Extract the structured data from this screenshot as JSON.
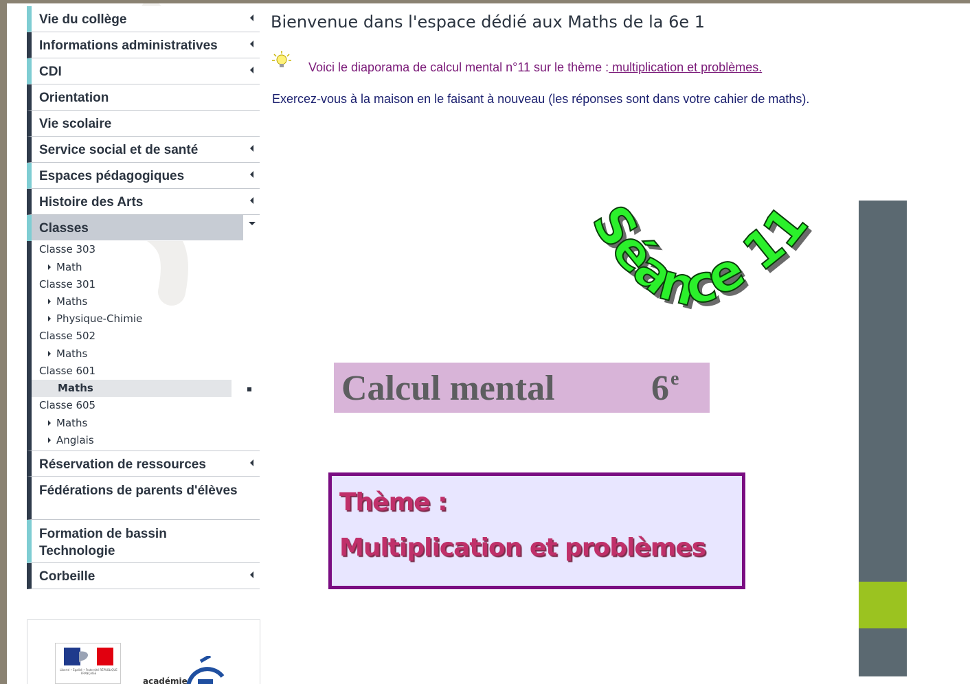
{
  "nav": {
    "menu": [
      {
        "label": "Vie du collège",
        "accent": true,
        "has_arrow": true
      },
      {
        "label": "Informations administratives",
        "accent": false,
        "has_arrow": true
      },
      {
        "label": "CDI",
        "accent": true,
        "has_arrow": true
      },
      {
        "label": "Orientation",
        "accent": false,
        "has_arrow": false
      },
      {
        "label": "Vie scolaire",
        "accent": false,
        "has_arrow": false
      },
      {
        "label": "Service social et de santé",
        "accent": false,
        "has_arrow": true
      },
      {
        "label": "Espaces pédagogiques",
        "accent": true,
        "has_arrow": true
      },
      {
        "label": "Histoire des Arts",
        "accent": false,
        "has_arrow": true
      },
      {
        "label": "Classes",
        "accent": true,
        "active": true
      }
    ],
    "classes": [
      {
        "name": "Classe 303",
        "items": [
          "Math"
        ]
      },
      {
        "name": "Classe 301",
        "items": [
          "Maths",
          "Physique-Chimie"
        ]
      },
      {
        "name": "Classe 502",
        "items": [
          "Maths"
        ]
      },
      {
        "name": "Classe 601",
        "items": [
          "Maths"
        ],
        "selected_item": "Maths"
      },
      {
        "name": "Classe 605",
        "items": [
          "Maths",
          "Anglais"
        ]
      }
    ],
    "menu_bottom": [
      {
        "label": "Réservation de ressources",
        "has_arrow": true
      },
      {
        "label": "Fédérations de parents d'élèves",
        "has_arrow": false
      },
      {
        "label": "Formation de bassin Technologie",
        "has_arrow": false,
        "accent": true
      },
      {
        "label": "Corbeille",
        "has_arrow": true
      }
    ]
  },
  "logos": {
    "rf_text": "Liberté • Égalité • Fraternité RÉPUBLIQUE FRANÇAISE",
    "academie": "académie"
  },
  "main": {
    "title": "Bienvenue dans l'espace dédié aux Maths de la 6e 1",
    "intro_text": "Voici le diaporama de calcul mental n°11 sur le thème :",
    "intro_link": " multiplication et problèmes.",
    "exercise_text": "Exercez-vous à la maison en le faisant  à nouveau (les réponses sont dans votre cahier de maths)."
  },
  "slide": {
    "seance_text": "Séance 11",
    "calcul_title": "Calcul mental",
    "level": "6",
    "level_sup": "e",
    "theme_label": "Thème :",
    "theme_value": "Multiplication  et problèmes"
  },
  "colors": {
    "menu_dark": "#2f3b4b",
    "menu_accent": "#7fcdd3",
    "link": "#7b1b79",
    "seance_green": "#2bf02b",
    "theme_pink": "#c0306a",
    "deco_slate": "#5b6971",
    "deco_green": "#9bc320"
  }
}
